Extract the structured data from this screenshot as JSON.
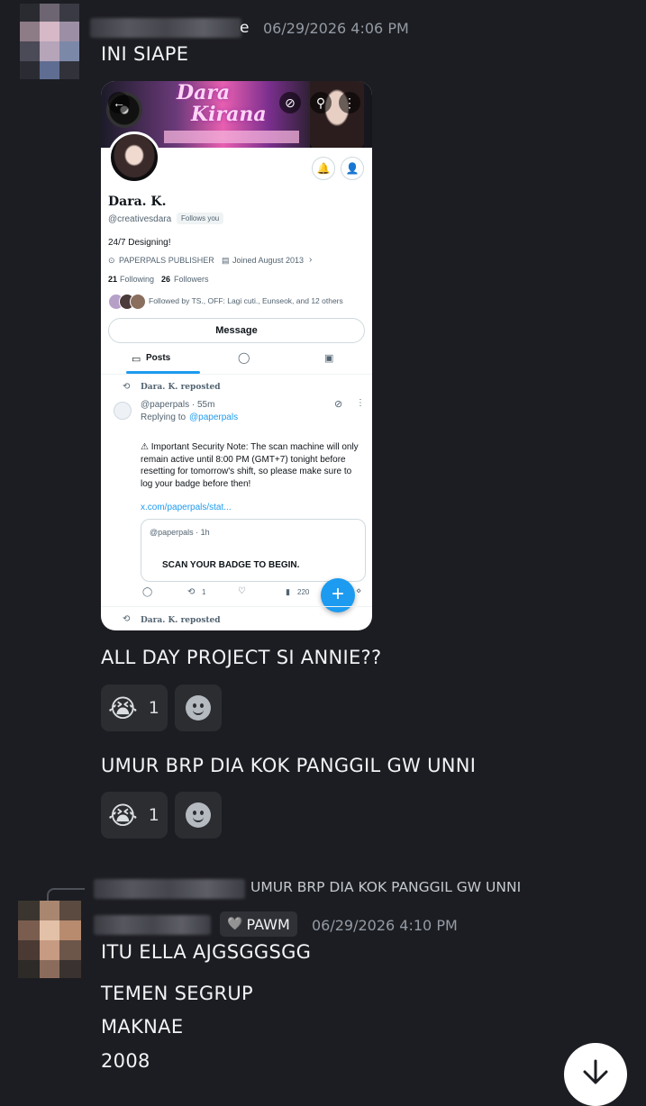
{
  "colors": {
    "background": "#1c1d22",
    "text": "#f2f3f5",
    "muted": "#949ba4",
    "tweet_blue": "#1d9bf0"
  },
  "message1": {
    "username_tail": "e",
    "timestamp": "06/29/2026 4:06 PM",
    "text": "INI SIAPE"
  },
  "screenshot": {
    "banner_title_1": "Dara",
    "banner_title_2": "Kirana",
    "display_name": "Dara. K.",
    "handle": "@creativesdara",
    "follows_you": "Follows you",
    "bio": "24/7 Designing!",
    "location": "PAPERPALS PUBLISHER",
    "joined": "Joined August 2013",
    "following_count": "21",
    "following_label": "Following",
    "followers_count": "26",
    "followers_label": "Followers",
    "followed_by": "Followed by TS., OFF: Lagi cuti., Eunseok, and 12 others",
    "message_button": "Message",
    "tab_posts": "Posts",
    "repost_label": "Dara. K. reposted",
    "tweet_author": "@paperpals · 55m",
    "replying_prefix": "Replying to",
    "replying_handle": "@paperpals",
    "tweet_body": "⚠ Important Security Note: The scan machine will only remain active until 8:00 PM (GMT+7) tonight before resetting for tomorrow's shift, so please make sure to log your badge before then!",
    "tweet_link": "x.com/paperpals/stat...",
    "quote_author": "@paperpals · 1h",
    "quote_text": "SCAN YOUR BADGE TO BEGIN.",
    "retweet_count": "1",
    "view_count": "220",
    "repost_label_2": "Dara. K. reposted"
  },
  "message2": {
    "text": "ALL DAY PROJECT SI ANNIE??",
    "reaction_emoji": "😭",
    "reaction_count": "1"
  },
  "message3": {
    "text": "UMUR BRP DIA KOK PANGGIL GW UNNI",
    "reaction_emoji": "😭",
    "reaction_count": "1"
  },
  "message4": {
    "reply_preview": "UMUR BRP DIA KOK PANGGIL GW UNNI",
    "role_badge_emoji": "🩶",
    "role_badge": "PAWM",
    "timestamp": "06/29/2026 4:10 PM",
    "lines": [
      "ITU ELLA AJGSGGSGG",
      "TEMEN SEGRUP",
      "MAKNAE",
      "2008"
    ]
  }
}
